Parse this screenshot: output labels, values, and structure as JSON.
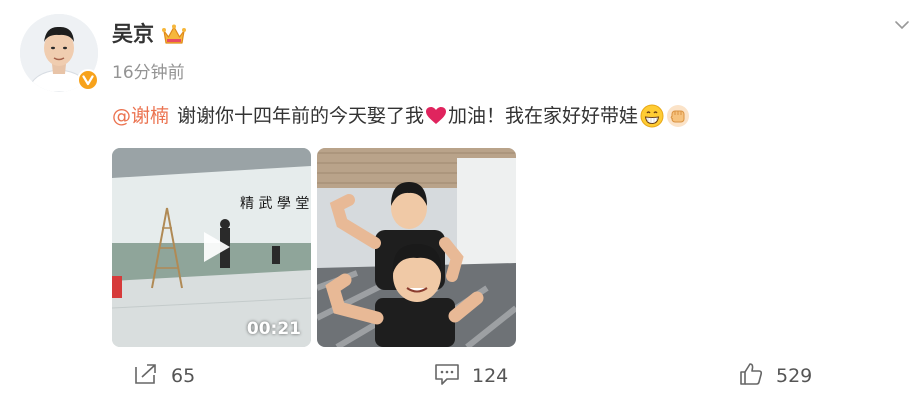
{
  "user": {
    "name": "吴京",
    "verified_badge_icon": "orange-v-verified-icon",
    "member_icon": "crown-icon"
  },
  "post": {
    "time": "16分钟前",
    "mention": "@谢楠",
    "text_part1": "谢谢你十四年前的今天娶了我",
    "heart_icon": "red-heart-icon",
    "text_part2": "加油！我在家好好带娃",
    "emoji_icons": [
      "grinning-face-icon",
      "raised-fist-icon"
    ]
  },
  "media": [
    {
      "type": "video",
      "duration": "00:21",
      "scene": "martial arts hall"
    },
    {
      "type": "image",
      "scene": "two boys flexing"
    }
  ],
  "actions": {
    "repost_count": "65",
    "comment_count": "124",
    "like_count": "529"
  },
  "colors": {
    "mention": "#eb7350",
    "heart": "#e0245e",
    "verified": "#f7a21b",
    "muted_text": "#939393"
  }
}
